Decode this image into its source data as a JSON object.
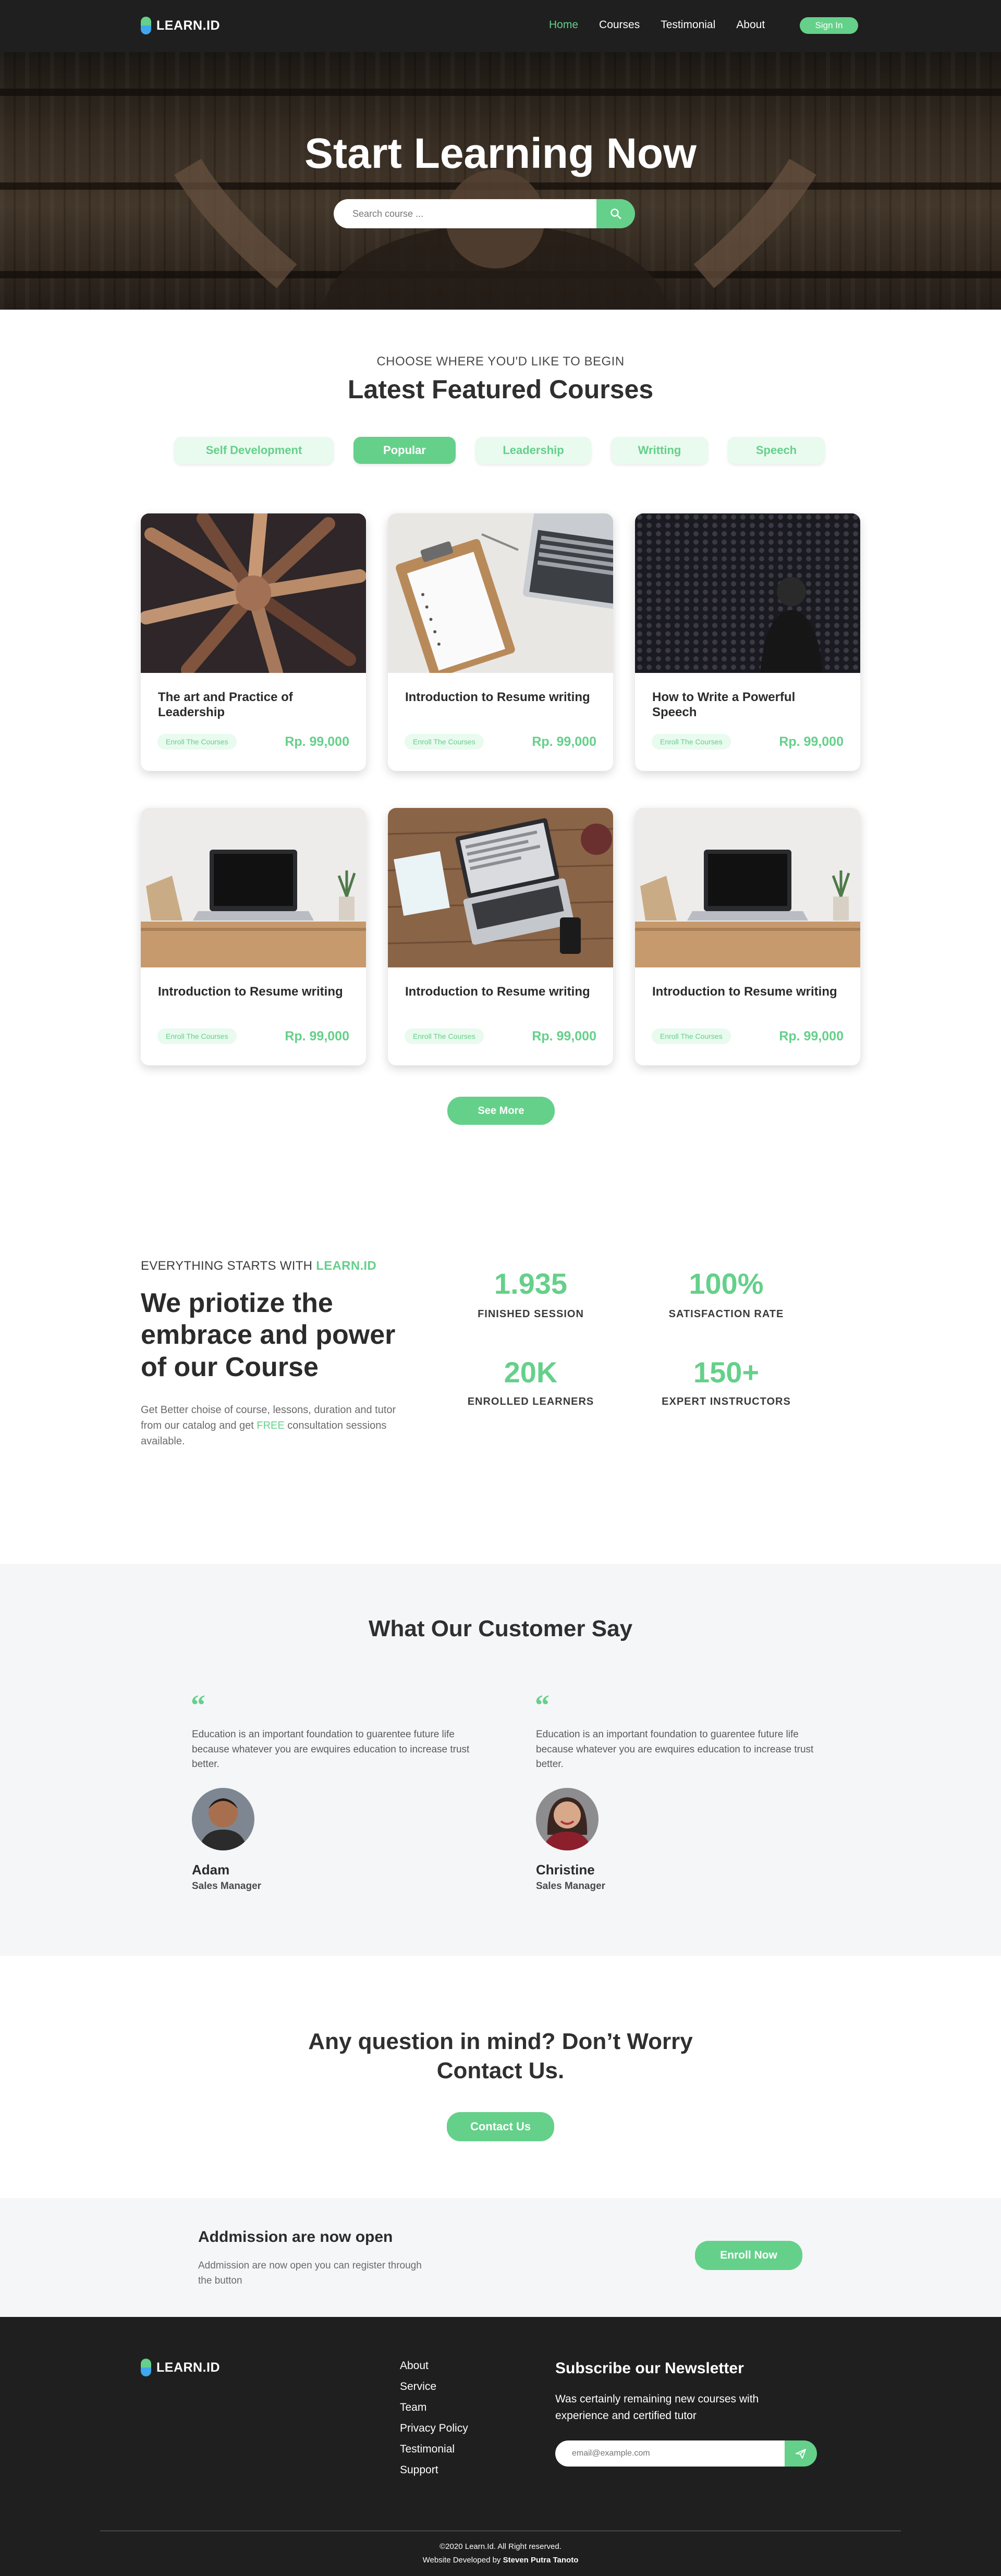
{
  "nav": {
    "logo": "LEARN.ID",
    "links": [
      "Home",
      "Courses",
      "Testimonial",
      "About"
    ],
    "signin": "Sign In"
  },
  "hero": {
    "title": "Start Learning Now",
    "search_placeholder": "Search course ..."
  },
  "courses": {
    "kicker": "CHOOSE WHERE YOU'D LIKE TO BEGIN",
    "title": "Latest Featured Courses",
    "tabs": [
      "Self Development",
      "Popular",
      "Leadership",
      "Writting",
      "Speech"
    ],
    "active_tab": "Popular",
    "items": [
      {
        "title": "The art and Practice of Leadership",
        "tag": "Enroll The Courses",
        "price": "Rp. 99,000"
      },
      {
        "title": "Introduction to Resume writing",
        "tag": "Enroll The Courses",
        "price": "Rp. 99,000"
      },
      {
        "title": "How to Write a Powerful Speech",
        "tag": "Enroll The Courses",
        "price": "Rp. 99,000"
      },
      {
        "title": "Introduction to Resume writing",
        "tag": "Enroll The Courses",
        "price": "Rp. 99,000"
      },
      {
        "title": "Introduction to Resume writing",
        "tag": "Enroll The Courses",
        "price": "Rp. 99,000"
      },
      {
        "title": "Introduction to Resume writing",
        "tag": "Enroll The Courses",
        "price": "Rp. 99,000"
      }
    ],
    "see_more": "See More"
  },
  "about": {
    "kicker": "EVERYTHING STARTS WITH",
    "kicker_brand": "LEARN.ID",
    "title": "We priotize the embrace and power of our Course",
    "text_before": "Get Better choise of course, lessons, duration and tutor from our catalog and get",
    "text_free": "FREE",
    "text_after": "consultation sessions available."
  },
  "stats": [
    {
      "value": "1.935",
      "label": "FINISHED SESSION"
    },
    {
      "value": "100%",
      "label": "SATISFACTION RATE"
    },
    {
      "value": "20K",
      "label": "ENROLLED LEARNERS"
    },
    {
      "value": "150+",
      "label": "EXPERT INSTRUCTORS"
    }
  ],
  "testimonials": {
    "title": "What Our Customer Say",
    "items": [
      {
        "text": "Education is an important foundation to guarentee future life because whatever you are ewquires education to increase trust better.",
        "name": "Adam",
        "role": "Sales Manager"
      },
      {
        "text": "Education is an important foundation to guarentee future life because whatever you are ewquires education to increase trust better.",
        "name": "Christine",
        "role": "Sales Manager"
      }
    ]
  },
  "contact": {
    "title_line1": "Any question in mind? Don’t Worry",
    "title_line2": "Contact Us.",
    "button": "Contact Us"
  },
  "admission": {
    "title": "Addmission are now open",
    "text": "Addmission are now open you can register through the button",
    "button": "Enroll Now"
  },
  "footer": {
    "logo": "LEARN.ID",
    "links": [
      "About",
      "Service",
      "Team",
      "Privacy Policy",
      "Testimonial",
      "Support"
    ],
    "newsletter_title": "Subscribe our Newsletter",
    "newsletter_text": "Was certainly remaining new courses with experience and certified tutor",
    "email_placeholder": "email@example.com",
    "copyright": "©2020 Learn.Id. All Right reserved.",
    "credit_prefix": "Website Developed by",
    "credit_name": "Steven Putra Tanoto"
  },
  "colors": {
    "accent": "#65d08a",
    "dark": "#1f1f1f",
    "band": "#f5f6f8"
  }
}
